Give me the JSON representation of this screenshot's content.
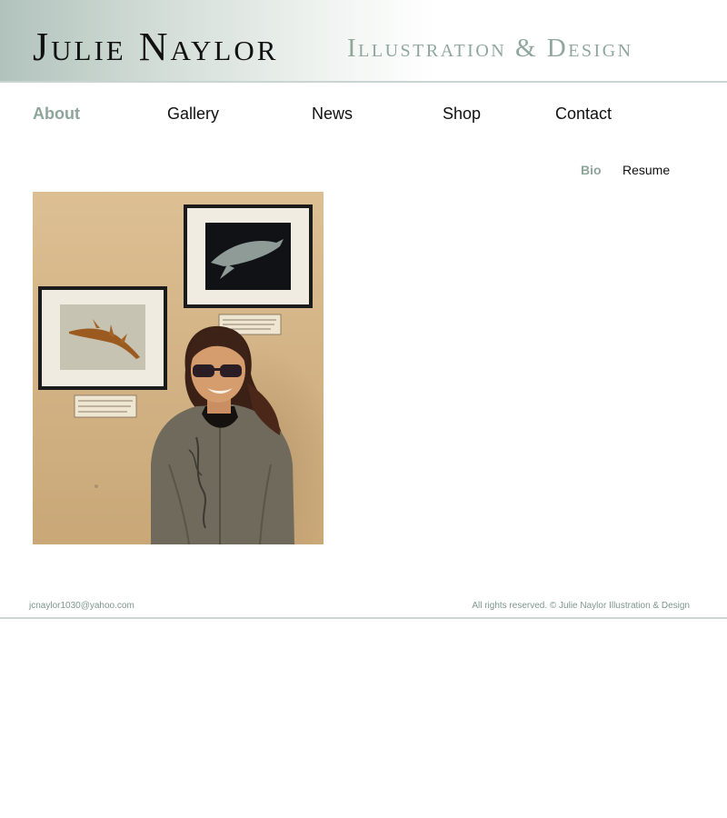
{
  "header": {
    "title": "Julie Naylor",
    "subtitle": "Illustration & Design"
  },
  "nav": {
    "items": [
      {
        "label": "About",
        "active": true
      },
      {
        "label": "Gallery",
        "active": false
      },
      {
        "label": "News",
        "active": false
      },
      {
        "label": "Shop",
        "active": false
      },
      {
        "label": "Contact",
        "active": false
      }
    ]
  },
  "subnav": {
    "items": [
      {
        "label": "Bio",
        "active": true
      },
      {
        "label": "Resume",
        "active": false
      }
    ]
  },
  "photo": {
    "icon": "portrait-photo"
  },
  "footer": {
    "email": "jcnaylor1030@yahoo.com",
    "rights": "All rights reserved.  © Julie Naylor Illustration & Design"
  },
  "colors": {
    "accent": "#8ea59c",
    "text": "#111111",
    "banner_start": "#b1c2bc"
  }
}
